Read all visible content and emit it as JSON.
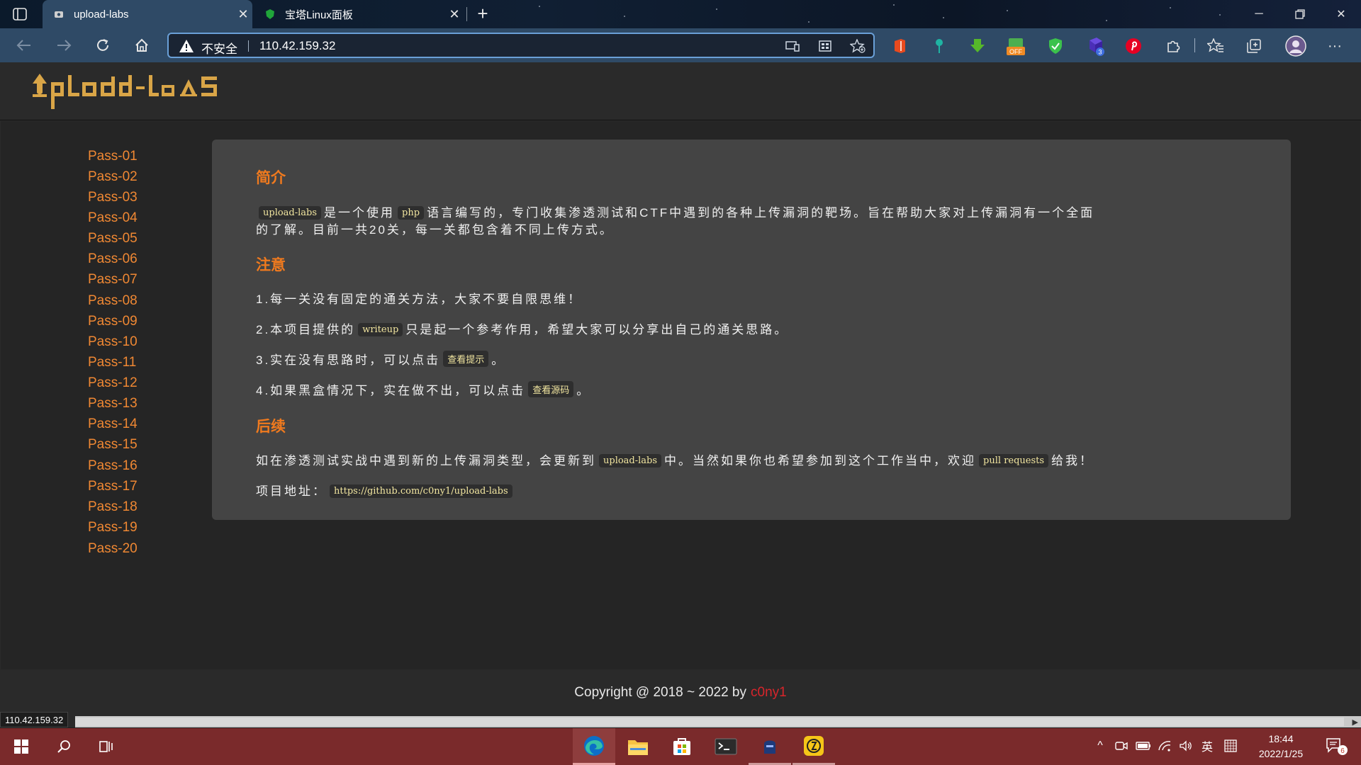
{
  "browser": {
    "tabs": [
      {
        "title": "upload-labs",
        "active": true
      },
      {
        "title": "宝塔Linux面板",
        "active": false
      }
    ],
    "address": {
      "security_label": "不安全",
      "url": "110.42.159.32"
    },
    "extension_badges": {
      "off_label": "OFF",
      "count_badge": "3"
    }
  },
  "site": {
    "logo_text": "UpLoad-labs",
    "nav": [
      "Pass-01",
      "Pass-02",
      "Pass-03",
      "Pass-04",
      "Pass-05",
      "Pass-06",
      "Pass-07",
      "Pass-08",
      "Pass-09",
      "Pass-10",
      "Pass-11",
      "Pass-12",
      "Pass-13",
      "Pass-14",
      "Pass-15",
      "Pass-16",
      "Pass-17",
      "Pass-18",
      "Pass-19",
      "Pass-20"
    ],
    "intro": {
      "heading": "简介",
      "code1": "upload-labs",
      "t1": "是一个使用",
      "code2": "php",
      "t2": "语言编写的，专门收集渗透测试和CTF中遇到的各种上传漏洞的靶场。旨在帮助大家对上传漏洞有一个全面",
      "t3": "的了解。目前一共20关，每一关都包含着不同上传方式。"
    },
    "notice": {
      "heading": "注意",
      "item1": "1.每一关没有固定的通关方法，大家不要自限思维！",
      "item2_pre": "2.本项目提供的",
      "item2_code": "writeup",
      "item2_post": "只是起一个参考作用，希望大家可以分享出自己的通关思路。",
      "item3_pre": "3.实在没有思路时，可以点击",
      "item3_link": "查看提示",
      "item3_post": "。",
      "item4_pre": "4.如果黑盒情况下，实在做不出，可以点击",
      "item4_link": "查看源码",
      "item4_post": "。"
    },
    "followup": {
      "heading": "后续",
      "t1": "如在渗透测试实战中遇到新的上传漏洞类型，会更新到",
      "code1": "upload-labs",
      "t2": "中。当然如果你也希望参加到这个工作当中，欢迎",
      "code2": "pull requests",
      "t3": "给我！",
      "project_label": "项目地址：",
      "project_url": "https://github.com/c0ny1/upload-labs"
    },
    "footer": {
      "copyright": "Copyright @ 2018 ~ 2022 by",
      "author": "c0ny1"
    },
    "status_url": "110.42.159.32"
  },
  "taskbar": {
    "ime": "英",
    "time": "18:44",
    "date": "2022/1/25",
    "notifications": "6"
  },
  "colors": {
    "accent_orange": "#f08833",
    "heading_orange": "#f07a1e",
    "author_red": "#d9252b",
    "taskbar": "#7a2a2b"
  }
}
